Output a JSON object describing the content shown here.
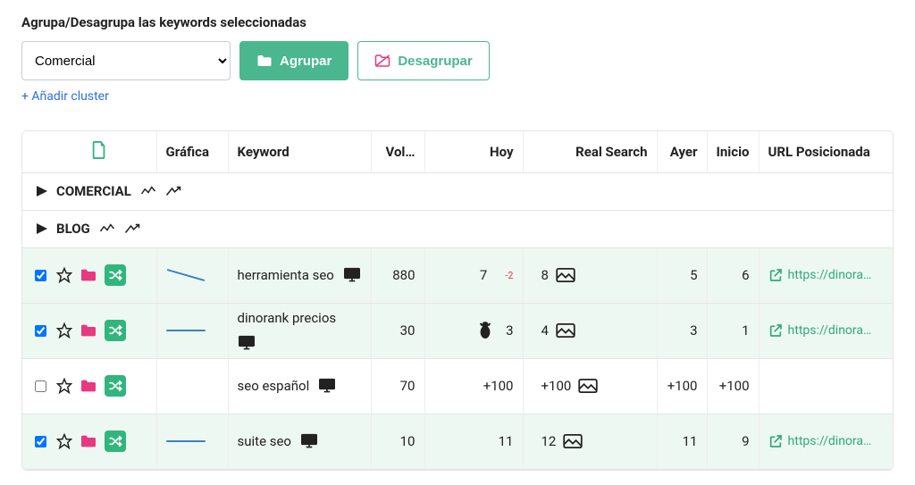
{
  "header": {
    "title": "Agrupa/Desagrupa las keywords seleccionadas",
    "selected_cluster": "Comercial",
    "agrupar_label": "Agrupar",
    "desagrupar_label": "Desagrupar",
    "add_cluster_label": "+ Añadir cluster"
  },
  "columns": {
    "grafica": "Gráfica",
    "keyword": "Keyword",
    "volumen": "Vol…",
    "hoy": "Hoy",
    "real_search": "Real Search",
    "ayer": "Ayer",
    "inicio": "Inicio",
    "url": "URL Posicionada"
  },
  "groups": [
    {
      "name": "COMERCIAL"
    },
    {
      "name": "BLOG"
    }
  ],
  "rows": [
    {
      "selected": true,
      "keyword": "herramienta seo",
      "vol": "880",
      "hoy": "7",
      "delta": "-2",
      "real": "8",
      "ayer": "5",
      "inicio": "6",
      "url": "https://dinora…",
      "graph": "down",
      "special_icon": false
    },
    {
      "selected": true,
      "keyword": "dinorank precios",
      "vol": "30",
      "hoy": "3",
      "delta": "",
      "real": "4",
      "ayer": "3",
      "inicio": "1",
      "url": "https://dinora…",
      "graph": "flat",
      "special_icon": true
    },
    {
      "selected": false,
      "keyword": "seo español",
      "vol": "70",
      "hoy": "+100",
      "delta": "",
      "real": "+100",
      "ayer": "+100",
      "inicio": "+100",
      "url": "",
      "graph": "none",
      "special_icon": false
    },
    {
      "selected": true,
      "keyword": "suite seo",
      "vol": "10",
      "hoy": "11",
      "delta": "",
      "real": "12",
      "ayer": "11",
      "inicio": "9",
      "url": "https://dinora…",
      "graph": "flat",
      "special_icon": false
    }
  ]
}
